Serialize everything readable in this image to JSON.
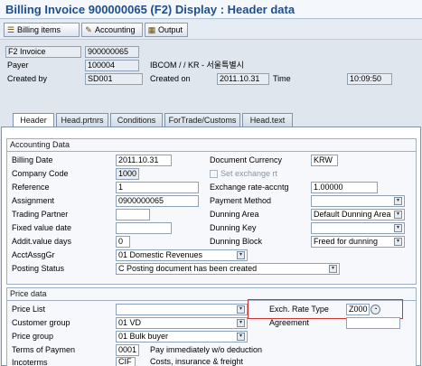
{
  "window": {
    "title": "Billing Invoice 900000065  (F2) Display : Header data"
  },
  "toolbar": {
    "items": [
      {
        "label": "Billing items",
        "icon": "billing-items-icon"
      },
      {
        "label": "Accounting",
        "icon": "accounting-icon"
      },
      {
        "label": "Output",
        "icon": "output-icon"
      }
    ]
  },
  "header": {
    "doc_type": "F2 Invoice",
    "doc_number": "900000065",
    "payer_label": "Payer",
    "payer_value": "100004",
    "payer_name": "IBCOM / / KR - 서울특별시",
    "created_by_label": "Created by",
    "created_by_value": "SD001",
    "created_on_label": "Created on",
    "created_on_value": "2011.10.31",
    "time_label": "Time",
    "time_value": "10:09:50"
  },
  "tabs": [
    {
      "label": "Header",
      "active": true
    },
    {
      "label": "Head.prtnrs",
      "active": false
    },
    {
      "label": "Conditions",
      "active": false
    },
    {
      "label": "ForTrade/Customs",
      "active": false
    },
    {
      "label": "Head.text",
      "active": false
    }
  ],
  "accounting": {
    "title": "Accounting Data",
    "billing_date_label": "Billing Date",
    "billing_date_value": "2011.10.31",
    "doc_currency_label": "Document Currency",
    "doc_currency_value": "KRW",
    "company_code_label": "Company Code",
    "company_code_value": "1000",
    "set_exchange_label": "Set exchange rt",
    "reference_label": "Reference",
    "reference_value": "1",
    "exch_rate_label": "Exchange rate-accntg",
    "exch_rate_value": "1.00000",
    "assignment_label": "Assignment",
    "assignment_value": "0900000065",
    "payment_method_label": "Payment Method",
    "payment_method_value": "",
    "trading_partner_label": "Trading Partner",
    "trading_partner_value": "",
    "dunning_area_label": "Dunning Area",
    "dunning_area_value": "Default Dunning Area",
    "fixed_value_label": "Fixed value date",
    "fixed_value_value": "",
    "dunning_key_label": "Dunning Key",
    "dunning_key_value": "",
    "addit_days_label": "Addit.value days",
    "addit_days_value": "0",
    "dunning_block_label": "Dunning Block",
    "dunning_block_value": "Freed for dunning",
    "acct_assg_label": "AcctAssgGr",
    "acct_assg_value": "01 Domestic Revenues",
    "posting_status_label": "Posting Status",
    "posting_status_value": "C Posting document has been created"
  },
  "price": {
    "title": "Price data",
    "price_list_label": "Price List",
    "price_list_value": "",
    "exch_rate_type_label": "Exch. Rate Type",
    "exch_rate_type_value": "Z000",
    "customer_group_label": "Customer group",
    "customer_group_value": "01 VD",
    "agreement_label": "Agreement",
    "agreement_value": "",
    "price_group_label": "Price group",
    "price_group_value": "01 Bulk buyer",
    "terms_label": "Terms of Paymen",
    "terms_code": "0001",
    "terms_text": "Pay immediately w/o deduction",
    "incoterms_label": "Incoterms",
    "incoterms_code": "CIF",
    "incoterms_text": "Costs, insurance & freight"
  },
  "colors": {
    "title": "#1f4e8c",
    "highlight": "#d3302f"
  }
}
